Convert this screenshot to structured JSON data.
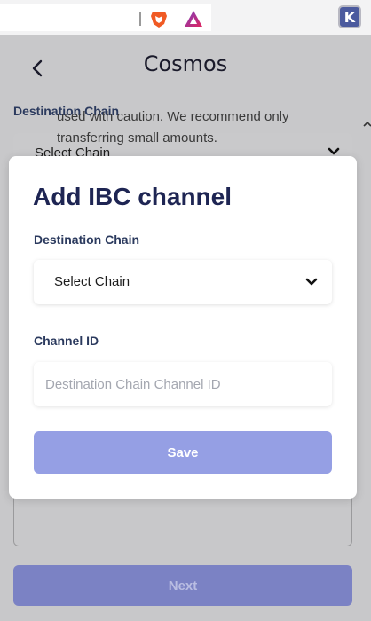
{
  "browser": {
    "extension_icons": [
      "brave-lion-icon",
      "triangle-alert-icon",
      "keplr-k-icon"
    ],
    "keplr_letter": "K"
  },
  "page": {
    "title": "Cosmos",
    "destination_label": "Destination Chain",
    "select_placeholder": "Select Chain",
    "warning_text": "used with caution. We recommend only transferring small amounts.",
    "next_label": "Next"
  },
  "modal": {
    "title": "Add IBC channel",
    "destination_label": "Destination Chain",
    "select_value": "Select Chain",
    "channel_label": "Channel ID",
    "channel_placeholder": "Destination Chain Channel ID",
    "channel_value": "",
    "save_label": "Save"
  },
  "colors": {
    "accent": "#959fe4",
    "title": "#1e2553",
    "label": "#2b3a5e",
    "overlay": "#c8c8ca"
  }
}
